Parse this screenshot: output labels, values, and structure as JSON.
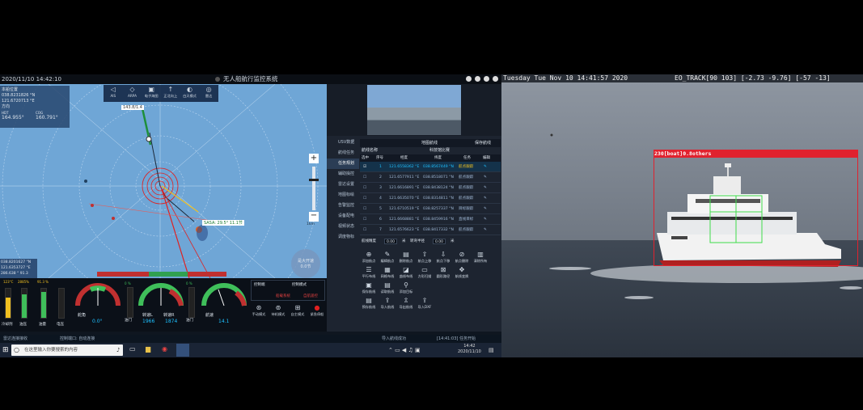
{
  "control_window": {
    "timestamp": "2020/11/10 14:42:10",
    "title": "无人船航行监控系统",
    "position_box": {
      "header": "本船位置",
      "lat": "038.8231826 °N",
      "lon": "121.6720713 °E",
      "heading_label": "方向",
      "hdt_label": "HDT",
      "cog_label": "COG",
      "hdt": "164.955°",
      "cog": "160.791°"
    },
    "map_toolbar": [
      {
        "icon": "ais-icon",
        "label": "AIS"
      },
      {
        "icon": "arpa-icon",
        "label": "ARPA"
      },
      {
        "icon": "chart-adjust-icon",
        "label": "电子海图"
      },
      {
        "icon": "north-up-icon",
        "label": "正北向上"
      },
      {
        "icon": "day-night-icon",
        "label": "白天模式"
      },
      {
        "icon": "radar-icon",
        "label": "雷达"
      }
    ],
    "bearing_readout": "143.8/1.4",
    "target_label": "SASA: 29.5° 11.1节",
    "cursor_box": {
      "lat": "038.8201627 °N",
      "lon": "121.6353727 °E",
      "extra": "286.638 °  91.3"
    },
    "zoom_label": "缩放",
    "scale_label": "1km",
    "speed_dial": {
      "label": "是大开速",
      "value": "0.0节"
    },
    "instruments": {
      "bars": [
        {
          "label": "冷却剂",
          "top": "123°C"
        },
        {
          "label": "油压",
          "top": "2885%"
        },
        {
          "label": "油量",
          "top": "91.3 %"
        },
        {
          "label": "电压",
          "top": ""
        }
      ],
      "rudder": {
        "label": "舵角",
        "value": "0.0°"
      },
      "throttle_l": {
        "label": "油门",
        "top": "0 %"
      },
      "rpm": {
        "left_label": "转速L",
        "left_value": "1966",
        "right_label": "转速R",
        "right_value": "1874"
      },
      "throttle_r": {
        "label": "油门",
        "top": "0 %"
      },
      "speed": {
        "label": "航速",
        "value": "14.1"
      },
      "control_box": {
        "left_title": "控制端",
        "right_title": "控制模式",
        "left_value": "船载系统",
        "right_value": "自航遥控"
      },
      "mode_buttons": [
        "手动模式",
        "待机模式",
        "自主模式",
        "紧急停船"
      ]
    },
    "right_panel": {
      "side_menu": [
        "USV数据",
        "航线任务",
        "任务规划",
        "辅助操控",
        "雷达设置",
        "地图标绘",
        "告警监控",
        "设备配电",
        "视频状态",
        "调度物标"
      ],
      "header": "编辑航线",
      "header2": "地图航线",
      "header2_action": "保存航线",
      "route_name_label": "航线名称",
      "route_name": "科技馆比赛",
      "table_headers": [
        "选中",
        "序号",
        "经度",
        "纬度",
        "任务",
        "编辑"
      ],
      "rows": [
        {
          "n": "1",
          "lon": "121.6558362 °E",
          "lat": "038.8567449 °N",
          "task": "航点跟踪",
          "selected": true
        },
        {
          "n": "2",
          "lon": "121.6577911 °E",
          "lat": "038.8518071 °N",
          "task": "航点跟踪",
          "selected": false
        },
        {
          "n": "3",
          "lon": "121.6616891 °E",
          "lat": "038.8438124 °N",
          "task": "航点跟踪",
          "selected": false
        },
        {
          "n": "4",
          "lon": "121.6635070 °E",
          "lat": "038.8314811 °N",
          "task": "航点跟踪",
          "selected": false
        },
        {
          "n": "5",
          "lon": "121.6710519 °E",
          "lat": "038.8257337 °N",
          "task": "目标跟踪",
          "selected": false
        },
        {
          "n": "6",
          "lon": "121.6668881 °E",
          "lat": "038.8459916 °N",
          "task": "直线目标",
          "selected": false
        },
        {
          "n": "7",
          "lon": "121.6576623 °E",
          "lat": "038.8417332 °N",
          "task": "航点跟踪",
          "selected": false
        }
      ],
      "param_row": {
        "label1": "航线精度",
        "v1": "0.00",
        "unit1": "米",
        "label2": "转弯半径",
        "v2": "0.00",
        "unit2": "米"
      },
      "tools_row1": [
        "添加航点",
        "编辑航点",
        "删除航点",
        "航点上移",
        "航点下移",
        "航点删除",
        "清除所有"
      ],
      "tools_row2": [
        "平行布线",
        "网格布线",
        "曲线布线",
        "方形扫描",
        "圆形路径",
        "航线变换"
      ],
      "tools_row3": [
        "保存航线",
        "读取航线",
        "添加目标"
      ],
      "tools_row4": [
        "预存航线",
        "导入航线",
        "导出航线",
        "导入DXF"
      ]
    },
    "status_bar": {
      "left1": "雷达连接接收",
      "left2": "控制端口: 自动连接",
      "center": "导入航线成功",
      "right": "[14:41:03] 任务开始"
    },
    "taskbar": {
      "search_placeholder": "在这里输入你要搜索的内容",
      "time": "14:42",
      "date": "2020/11/10"
    }
  },
  "camera_feed": {
    "header_left": "Tuesday Tue Nov 10 14:41:57 2020",
    "header_right": "EO_TRACK[90 103] [-2.73 -9.76] [-57 -13]",
    "detection_label": "230[boat]0.8others",
    "colors": {
      "detection": "#e0222e",
      "tracker": "#3fdc4a"
    }
  }
}
